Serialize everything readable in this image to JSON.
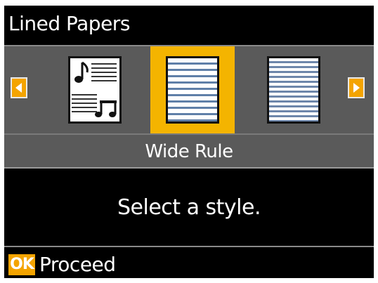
{
  "screen": {
    "title": "Lined Papers"
  },
  "carousel": {
    "items": [
      {
        "name": "Music Sheet",
        "icon": "music-staff-paper-icon",
        "selected": false
      },
      {
        "name": "Wide Rule",
        "icon": "wide-ruled-paper-icon",
        "selected": true
      },
      {
        "name": "Narrow Rule",
        "icon": "narrow-ruled-paper-icon",
        "selected": false
      }
    ],
    "selected_name": "Wide Rule",
    "left_arrow_icon": "left-arrow-icon",
    "right_arrow_icon": "right-arrow-icon"
  },
  "message": {
    "instruction": "Select a style."
  },
  "footer": {
    "ok_key": "OK",
    "ok_action": "Proceed"
  },
  "colors": {
    "accent": "#f4a400",
    "selected_highlight": "#f4b400",
    "panel_gray": "#5a5a5a",
    "background": "#000000",
    "text": "#ffffff"
  }
}
